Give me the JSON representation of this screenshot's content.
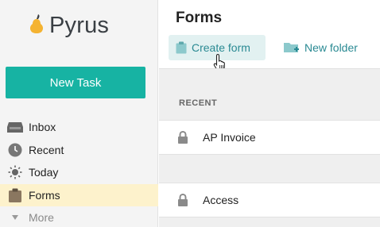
{
  "app": {
    "logo_text": "Pyrus"
  },
  "sidebar": {
    "new_task_label": "New Task",
    "items": [
      {
        "label": "Inbox",
        "icon": "inbox-icon"
      },
      {
        "label": "Recent",
        "icon": "clock-icon"
      },
      {
        "label": "Today",
        "icon": "sun-icon"
      },
      {
        "label": "Forms",
        "icon": "clipboard-icon",
        "active": true
      },
      {
        "label": "More",
        "icon": "chevron-down-icon"
      }
    ]
  },
  "main": {
    "title": "Forms",
    "create_form_label": "Create form",
    "new_folder_label": "New folder",
    "section_label": "RECENT",
    "rows": [
      {
        "label": "AP Invoice",
        "icon": "lock-icon"
      },
      {
        "label": "Access",
        "icon": "lock-icon"
      }
    ]
  },
  "colors": {
    "accent": "#17b3a3",
    "link": "#2a8a93",
    "active_nav": "#fdf2cc",
    "logo_pear": "#f4b331"
  }
}
